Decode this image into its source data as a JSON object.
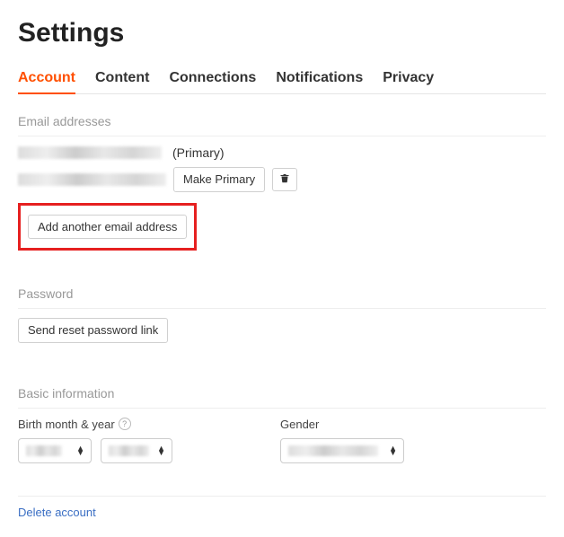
{
  "page_title": "Settings",
  "tabs": {
    "account": "Account",
    "content": "Content",
    "connections": "Connections",
    "notifications": "Notifications",
    "privacy": "Privacy"
  },
  "sections": {
    "email_addresses": "Email addresses",
    "password": "Password",
    "basic_information": "Basic information"
  },
  "email": {
    "primary_suffix": "(Primary)",
    "make_primary_label": "Make Primary",
    "add_another_label": "Add another email address"
  },
  "password_section": {
    "send_reset_label": "Send reset password link"
  },
  "basic": {
    "birth_label": "Birth month & year",
    "gender_label": "Gender"
  },
  "footer": {
    "delete_account": "Delete account"
  }
}
